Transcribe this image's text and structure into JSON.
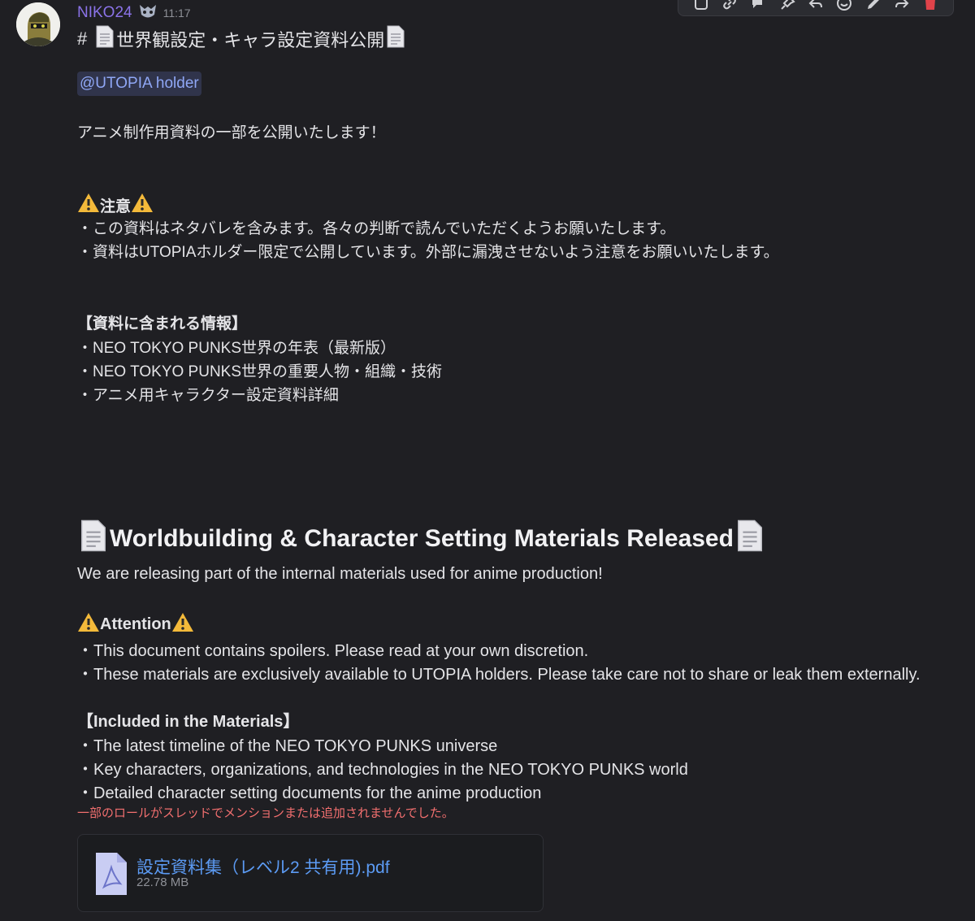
{
  "message": {
    "author": "NIKO24",
    "timestamp": "11:17",
    "heading_prefix": "#",
    "heading_jp": "世界観設定・キャラ設定資料公開",
    "mention": "@UTOPIA holder",
    "intro_jp": "アニメ制作用資料の一部を公開いたします！",
    "caution_jp": "注意",
    "caution_lines_jp": [
      "・この資料はネタバレを含みます。各々の判断で読んでいただくようお願いたします。",
      "・資料はUTOPIAホルダー限定で公開しています。外部に漏洩させないよう注意をお願いいたします。"
    ],
    "included_jp": "【資料に含まれる情報】",
    "included_lines_jp": [
      "・NEO TOKYO PUNKS世界の年表（最新版）",
      "・NEO TOKYO PUNKS世界の重要人物・組織・技術",
      "・アニメ用キャラクター設定資料詳細"
    ],
    "heading_en": "Worldbuilding & Character Setting Materials Released",
    "intro_en": "We are releasing part of the internal materials used for anime production!",
    "attention_en": "Attention",
    "attention_lines_en": [
      "・This document contains spoilers. Please read at your own discretion.",
      "・These materials are exclusively available to UTOPIA holders. Please take care not to share or leak them externally."
    ],
    "included_en": "【Included in the Materials】",
    "included_lines_en": [
      "・The latest timeline of the NEO TOKYO PUNKS universe",
      "・Key characters, organizations, and technologies in the NEO TOKYO PUNKS world",
      "・Detailed character setting documents for the anime production"
    ],
    "system_notice": "一部のロールがスレッドでメンションまたは追加されませんでした。"
  },
  "attachment": {
    "filename": "設定資料集（レベル2 共有用).pdf",
    "size": "22.78 MB",
    "icon": "pdf-file-icon"
  },
  "toolbar_icons": [
    "app-icon",
    "link-icon",
    "thread-icon",
    "pin-icon",
    "reply-icon",
    "reaction-icon",
    "edit-icon",
    "forward-icon",
    "delete-icon"
  ],
  "colors": {
    "background": "#1f1f23",
    "author": "#8b73e8",
    "mention_bg": "#30344b",
    "mention_text": "#8fa7f5",
    "link": "#5c9bf4",
    "notice": "#f26f6f",
    "delete": "#e0434a"
  }
}
